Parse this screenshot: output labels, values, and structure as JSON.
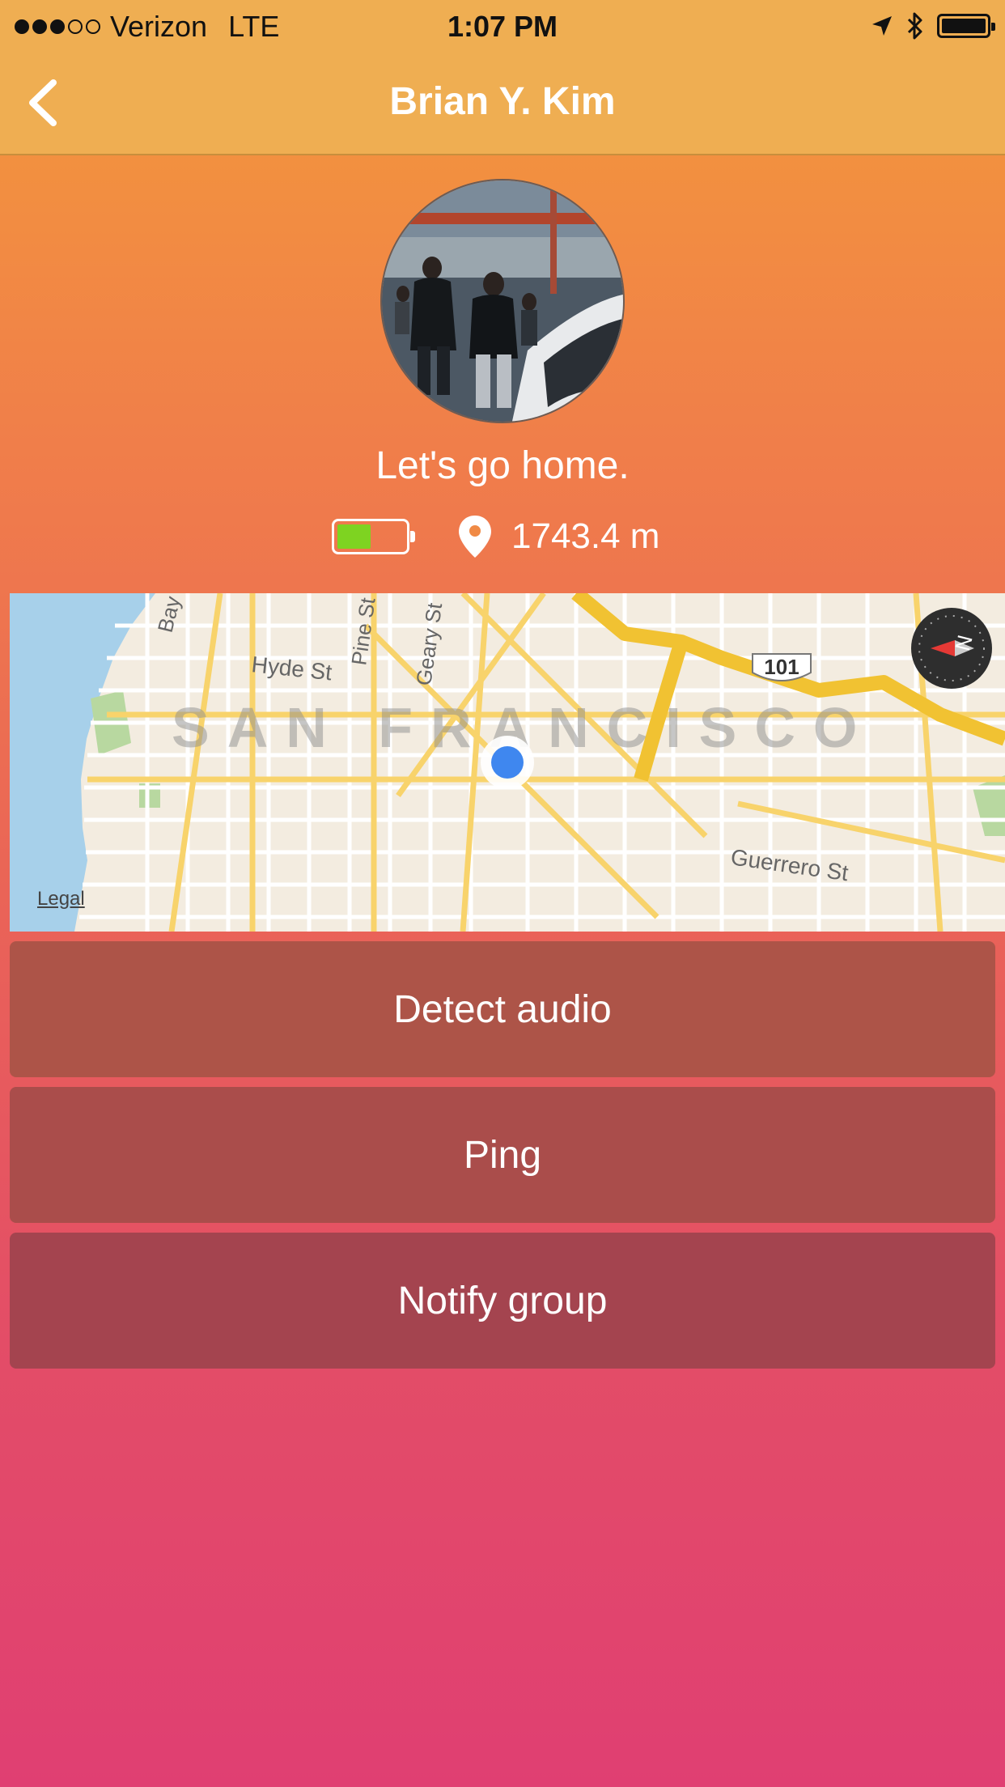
{
  "status_bar": {
    "carrier": "Verizon",
    "network": "LTE",
    "time": "1:07 PM",
    "signal_bars_filled": 3,
    "signal_bars_total": 5,
    "battery_level": 1.0
  },
  "nav": {
    "title": "Brian Y. Kim",
    "back_icon": "chevron-left-icon"
  },
  "profile": {
    "status_message": "Let's go home.",
    "battery_level": 0.5,
    "battery_color": "#7ed321",
    "distance": "1743.4 m"
  },
  "map": {
    "city_label": "SAN FRANCISCO",
    "street_labels": [
      "Hyde St",
      "Pine St",
      "Geary St",
      "Bay",
      "Guerrero St"
    ],
    "highway_shield": "101",
    "legal_link": "Legal",
    "compass_label": "N"
  },
  "actions": [
    {
      "label": "Detect audio"
    },
    {
      "label": "Ping"
    },
    {
      "label": "Notify group"
    }
  ],
  "colors": {
    "nav_bar": "#efae52",
    "gradient_top": "#f49a3a",
    "gradient_bottom": "#e03f72",
    "button_1": "#ad5448",
    "button_2": "#aa4d4b",
    "button_3": "#a4444f"
  }
}
